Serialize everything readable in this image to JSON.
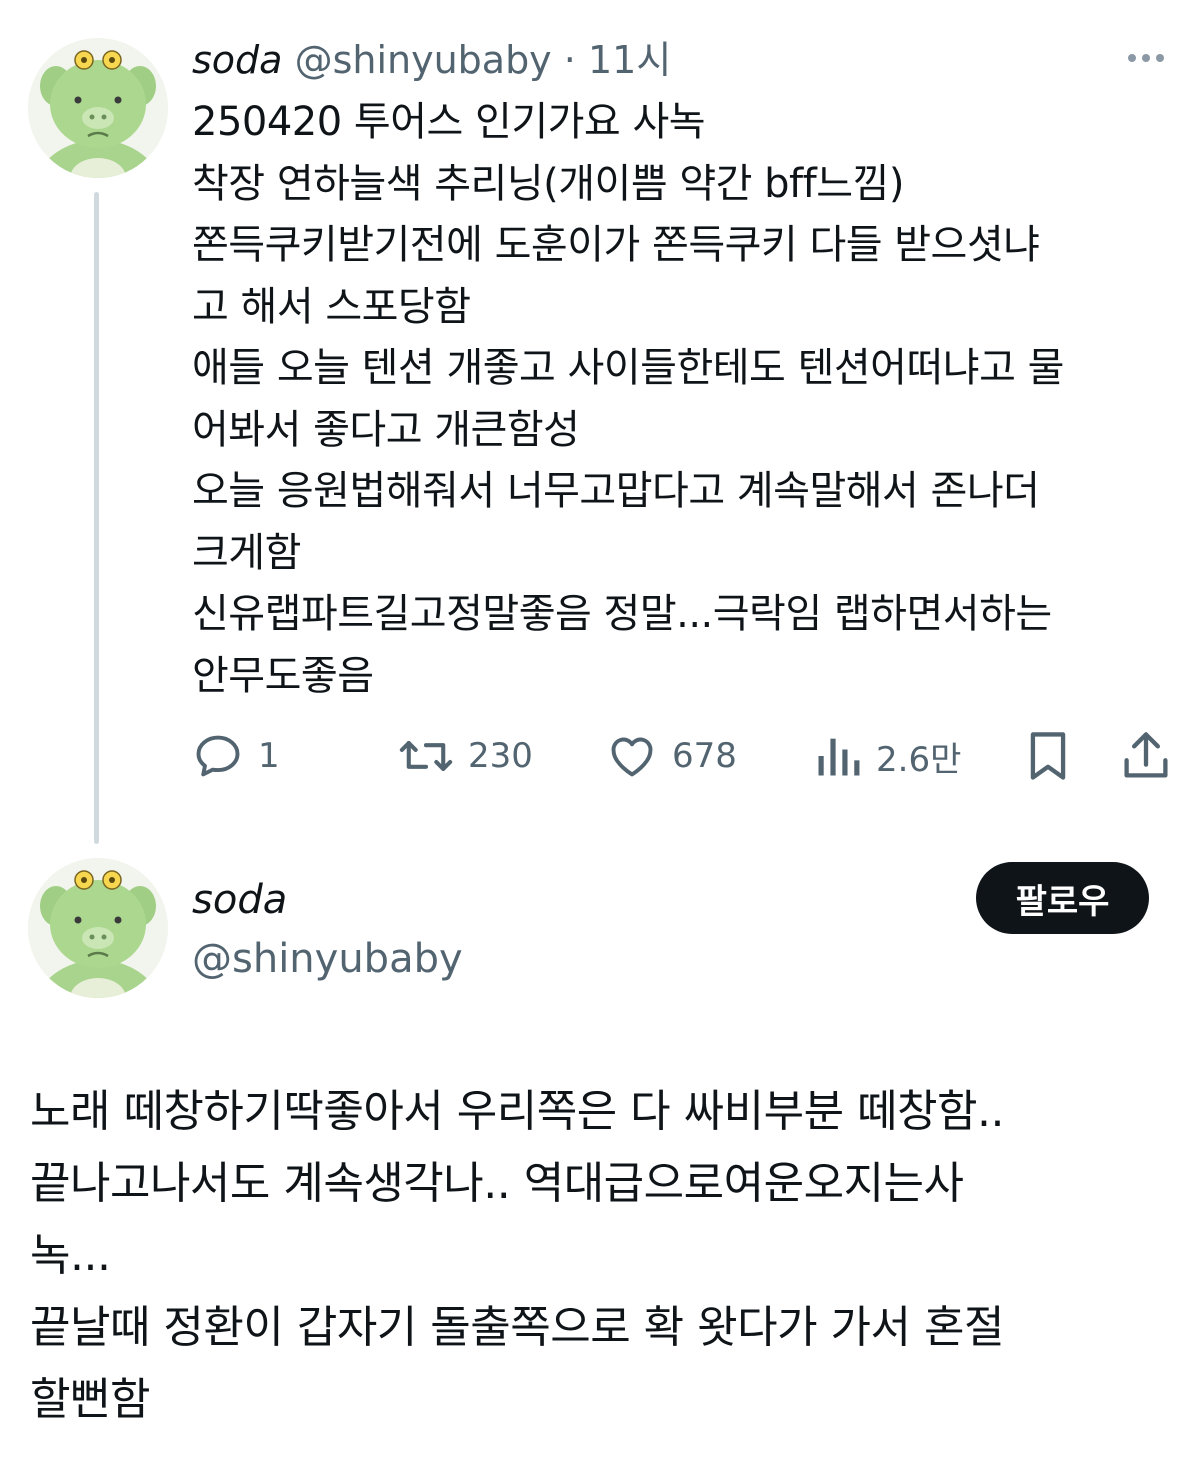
{
  "tweet": {
    "name": "soda",
    "handle": "@shinyubaby",
    "separator": "·",
    "time": "11시",
    "lines": [
      "250420 투어스 인기가요 사녹",
      "착장 연하늘색 추리닝(개이쁨 약간 bff느낌)",
      "쫀득쿠키받기전에 도훈이가 쫀득쿠키 다들 받으셧냐",
      "고 해서 스포당함",
      "애들 오늘 텐션 개좋고 사이들한테도 텐션어떠냐고 물",
      "어봐서 좋다고 개큰함성",
      "오늘 응원법해줘서 너무고맙다고 계속말해서 존나더",
      "크게함",
      "신유랩파트길고정말좋음 정말...극락임 랩하면서하는",
      "안무도좋음"
    ],
    "stats": {
      "replies": "1",
      "retweets": "230",
      "likes": "678",
      "views": "2.6만"
    }
  },
  "reply": {
    "name": "soda",
    "handle": "@shinyubaby",
    "follow_label": "팔로우",
    "lines": [
      "노래 떼창하기딱좋아서 우리쪽은 다 싸비부분 떼창함..",
      "끝나고나서도 계속생각나.. 역대급으로여운오지는사",
      "녹...",
      "끝날때 정환이 갑자기 돌출쪽으로 확 왓다가 가서 혼절",
      "할뻔함"
    ]
  },
  "colors": {
    "text": "#0f1419",
    "secondary": "#536471",
    "thread_line": "#cfd9de",
    "button_bg": "#0f1419",
    "avatar_green": "#a6d38a"
  },
  "icons": [
    "more-icon",
    "reply-icon",
    "retweet-icon",
    "like-icon",
    "views-icon",
    "bookmark-icon",
    "share-icon"
  ]
}
